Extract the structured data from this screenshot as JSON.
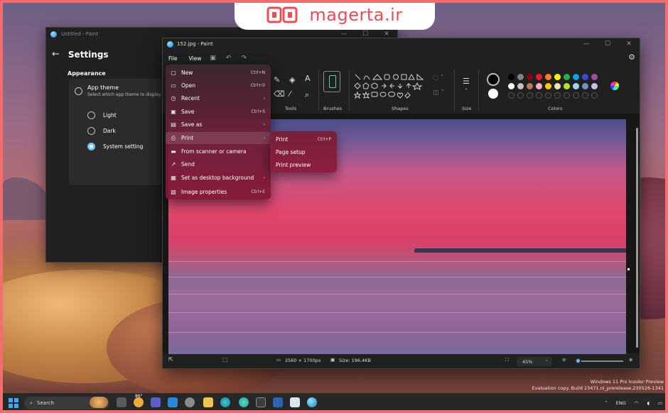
{
  "banner": {
    "text": "magerta.ir",
    "brand_color": "#e84d57"
  },
  "settings_window": {
    "titlebar": "Untitled - Paint",
    "title": "Settings",
    "section": "Appearance",
    "card_title": "App theme",
    "card_subtitle": "Select which app theme to display",
    "options": [
      "Light",
      "Dark",
      "System setting"
    ],
    "selected": "System setting"
  },
  "paint": {
    "title": "152.jpg - Paint",
    "menu": {
      "file": "File",
      "view": "View"
    },
    "ribbon_labels": {
      "tools": "Tools",
      "brushes": "Brushes",
      "shapes": "Shapes",
      "size": "Size",
      "colors": "Colors"
    },
    "status": {
      "dimensions": "2560 × 1700px",
      "size": "Size: 196.4KB",
      "zoom": "45%"
    },
    "accent_color": "#6cc6ff",
    "palette": [
      "#000000",
      "#7f7f7f",
      "#880015",
      "#ed1c24",
      "#ff7f27",
      "#fff200",
      "#22b14c",
      "#00a2e8",
      "#3f48cc",
      "#a349a4",
      "#ffffff",
      "#c3c3c3",
      "#b97a57",
      "#ffaec9",
      "#ffc90e",
      "#efe4b0",
      "#b5e61d",
      "#99d9ea",
      "#7092be",
      "#c8bfe7"
    ]
  },
  "file_menu": {
    "items": [
      {
        "label": "New",
        "shortcut": "Ctrl+N",
        "icon": "new-file-icon"
      },
      {
        "label": "Open",
        "shortcut": "Ctrl+O",
        "icon": "open-folder-icon"
      },
      {
        "label": "Recent",
        "shortcut": "›",
        "icon": "recent-clock-icon"
      },
      {
        "label": "Save",
        "shortcut": "Ctrl+S",
        "icon": "save-icon"
      },
      {
        "label": "Save as",
        "shortcut": "›",
        "icon": "save-as-icon"
      },
      {
        "label": "Print",
        "shortcut": "›",
        "icon": "print-icon"
      },
      {
        "label": "From scanner or camera",
        "shortcut": "",
        "icon": "scanner-icon"
      },
      {
        "label": "Send",
        "shortcut": "",
        "icon": "send-icon"
      },
      {
        "label": "Set as desktop background",
        "shortcut": "›",
        "icon": "desktop-background-icon"
      },
      {
        "label": "Image properties",
        "shortcut": "Ctrl+E",
        "icon": "image-properties-icon"
      }
    ]
  },
  "print_submenu": {
    "items": [
      "Print",
      "Page setup",
      "Print preview"
    ],
    "print_shortcut": "Ctrl+P"
  },
  "windows_watermark": {
    "line1": "Windows 11 Pro Insider Preview",
    "line2": "Evaluation copy. Build 23471.ni_prerelease.230526-1341"
  },
  "taskbar": {
    "search": "Search",
    "weather": "86°",
    "language": "ENG"
  }
}
